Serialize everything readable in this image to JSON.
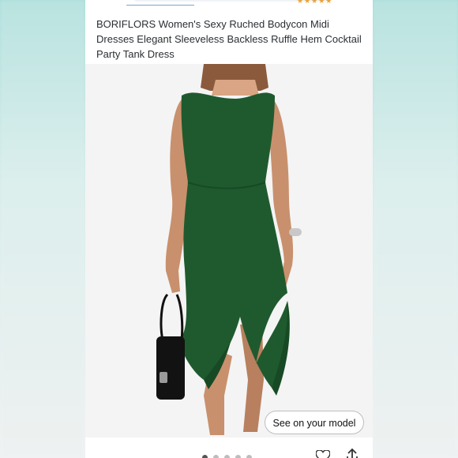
{
  "product": {
    "title": "BORIFLORS Women's Sexy Ruched Bodycon Midi Dresses Elegant Sleeveless Backless Ruffle Hem Cocktail Party Tank Dress"
  },
  "image": {
    "dress_color": "#1f5a2e",
    "background_color": "#f4f4f4"
  },
  "actions": {
    "see_on_model_label": "See on your model"
  },
  "carousel": {
    "dot_count": 5,
    "active_index": 0
  },
  "icons": {
    "favorite": "heart-icon",
    "share": "share-icon"
  }
}
